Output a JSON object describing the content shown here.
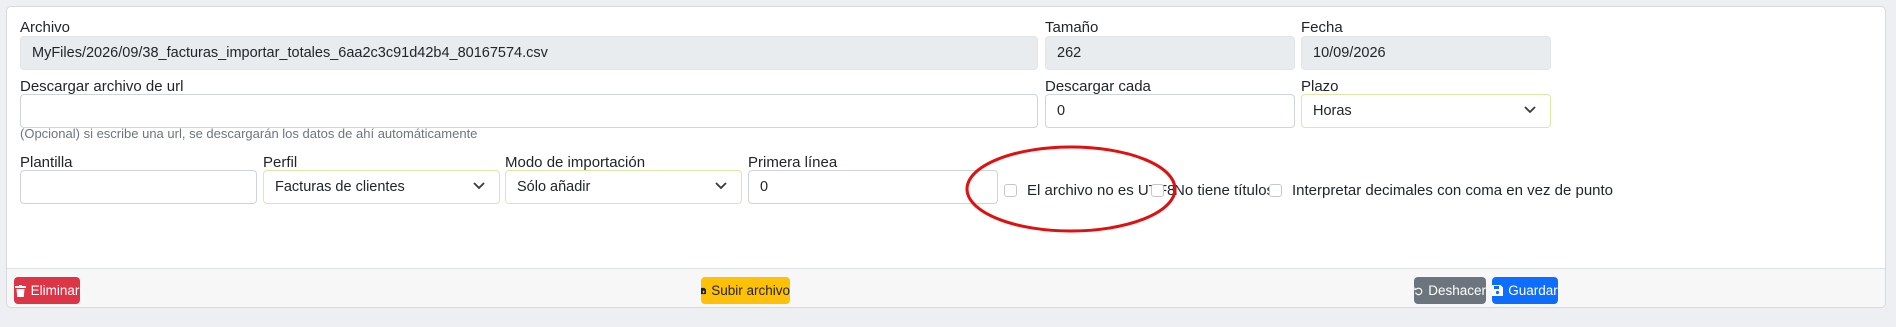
{
  "file": {
    "label": "Archivo",
    "value": "MyFiles/2026/09/38_facturas_importar_totales_6aa2c3c91d42b4_80167574.csv"
  },
  "size": {
    "label": "Tamaño",
    "value": "262"
  },
  "date": {
    "label": "Fecha",
    "value": "10/09/2026"
  },
  "download_url": {
    "label": "Descargar archivo de url",
    "value": "",
    "help": "(Opcional) si escribe una url, se descargarán los datos de ahí automáticamente"
  },
  "download_every": {
    "label": "Descargar cada",
    "value": "0"
  },
  "term": {
    "label": "Plazo",
    "value": "Horas"
  },
  "template": {
    "label": "Plantilla",
    "value": ""
  },
  "profile": {
    "label": "Perfil",
    "value": "Facturas de clientes"
  },
  "import_mode": {
    "label": "Modo de importación",
    "value": "Sólo añadir"
  },
  "first_line": {
    "label": "Primera línea",
    "value": "0"
  },
  "options": {
    "not_utf8": "El archivo no es UTF8",
    "no_titles": "No tiene títulos",
    "comma_decimals": "Interpretar decimales con coma en vez de punto"
  },
  "footer": {
    "delete_label": "Eliminar",
    "upload_label": "Subir archivo",
    "undo_label": "Deshacer",
    "save_label": "Guardar"
  },
  "colors": {
    "danger": "#dc3545",
    "warning": "#ffc107",
    "secondary": "#6c757d",
    "primary": "#0d6efd",
    "annotation": "#e01010"
  },
  "icons": {
    "delete": "trash-icon",
    "upload": "file-upload-icon",
    "undo": "undo-icon",
    "save": "save-icon",
    "select": "chevron-down-icon"
  }
}
